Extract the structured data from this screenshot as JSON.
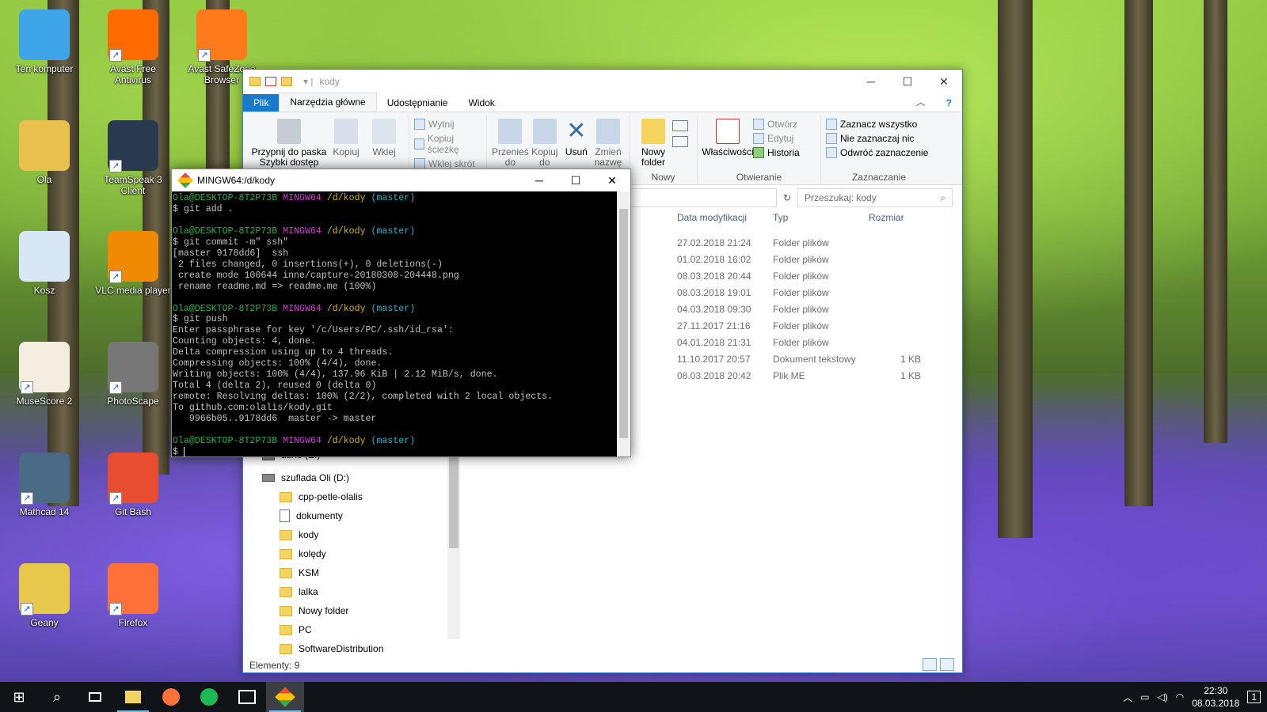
{
  "desktop": {
    "icons": [
      {
        "label": "Ten komputer",
        "color": "#3ea5e8"
      },
      {
        "label": "Avast Free Antivirus",
        "color": "#ff6b00"
      },
      {
        "label": "Avast SafeZone Browser",
        "color": "#ff7a1a"
      },
      {
        "label": "Ola",
        "color": "#e9c04d"
      },
      {
        "label": "TeamSpeak 3 Client",
        "color": "#2a3a4e"
      },
      {
        "label": "Kosz",
        "color": "#d8e7f5"
      },
      {
        "label": "VLC media player",
        "color": "#f08a00"
      },
      {
        "label": "MuseScore 2",
        "color": "#f3eee0"
      },
      {
        "label": "PhotoScape",
        "color": "#777777"
      },
      {
        "label": "Mathcad 14",
        "color": "#4a6a86"
      },
      {
        "label": "Git Bash",
        "color": "#e84d31"
      },
      {
        "label": "Geany",
        "color": "#e8c84a"
      },
      {
        "label": "Firefox",
        "color": "#ff7139"
      }
    ]
  },
  "explorer": {
    "title": "kody",
    "tabs": [
      "Plik",
      "Narzędzia główne",
      "Udostępnianie",
      "Widok"
    ],
    "ribbon": {
      "pin": "Przypnij do paska Szybki dostęp",
      "copy": "Kopiuj",
      "paste": "Wklej",
      "cut": "Wytnij",
      "copy_path": "Kopiuj ścieżkę",
      "paste_shortcut": "Wklej skrót",
      "move": "Przenieś do",
      "copy_to": "Kopiuj do",
      "delete": "Usuń",
      "rename": "Zmień nazwę",
      "new_folder": "Nowy folder",
      "group_new": "Nowy",
      "properties": "Właściwości",
      "open": "Otwórz",
      "edit": "Edytuj",
      "history": "Historia",
      "group_open": "Otwieranie",
      "select_all": "Zaznacz wszystko",
      "select_none": "Nie zaznaczaj nic",
      "invert": "Odwróć zaznaczenie",
      "group_select": "Zaznaczanie"
    },
    "search_placeholder": "Przeszukaj: kody",
    "columns": [
      "Data modyfikacji",
      "Typ",
      "Rozmiar"
    ],
    "files": [
      {
        "date": "27.02.2018 21:24",
        "type": "Folder plików",
        "size": ""
      },
      {
        "date": "01.02.2018 16:02",
        "type": "Folder plików",
        "size": ""
      },
      {
        "date": "08.03.2018 20:44",
        "type": "Folder plików",
        "size": ""
      },
      {
        "date": "08.03.2018 19:01",
        "type": "Folder plików",
        "size": ""
      },
      {
        "date": "04.03.2018 09:30",
        "type": "Folder plików",
        "size": ""
      },
      {
        "date": "27.11.2017 21:16",
        "type": "Folder plików",
        "size": ""
      },
      {
        "date": "04.01.2018 21:31",
        "type": "Folder plików",
        "size": ""
      },
      {
        "date": "11.10.2017 20:57",
        "type": "Dokument tekstowy",
        "size": "1 KB"
      },
      {
        "date": "08.03.2018 20:42",
        "type": "Plik ME",
        "size": "1 KB"
      }
    ],
    "nav": {
      "drive_partial": "dane (E:)",
      "drive": "szuflada Oli (D:)",
      "items": [
        "cpp-petle-olalis",
        "dokumenty",
        "kody",
        "kolędy",
        "KSM",
        "lalka",
        "Nowy folder",
        "PC",
        "SoftwareDistribution"
      ]
    },
    "status": "Elementy: 9"
  },
  "terminal": {
    "title": "MINGW64:/d/kody",
    "user": "Ola@DESKTOP-8T2P73B",
    "env": "MINGW64",
    "path": "/d/kody",
    "branch": "(master)",
    "cmd1": "$ git add .",
    "cmd2": "$ git commit -m\" ssh\"",
    "out2": [
      "[master 9178dd6]  ssh",
      " 2 files changed, 0 insertions(+), 0 deletions(-)",
      " create mode 100644 inne/capture-20180308-204448.png",
      " rename readme.md => readme.me (100%)"
    ],
    "cmd3": "$ git push",
    "out3": [
      "Enter passphrase for key '/c/Users/PC/.ssh/id_rsa':",
      "Counting objects: 4, done.",
      "Delta compression using up to 4 threads.",
      "Compressing objects: 100% (4/4), done.",
      "Writing objects: 100% (4/4), 137.96 KiB | 2.12 MiB/s, done.",
      "Total 4 (delta 2), reused 0 (delta 0)",
      "remote: Resolving deltas: 100% (2/2), completed with 2 local objects.",
      "To github.com:olalis/kody.git",
      "   9966b05..9178dd6  master -> master"
    ],
    "prompt": "$ "
  },
  "taskbar": {
    "time": "22:30",
    "date": "08.03.2018",
    "notifications": "1"
  }
}
